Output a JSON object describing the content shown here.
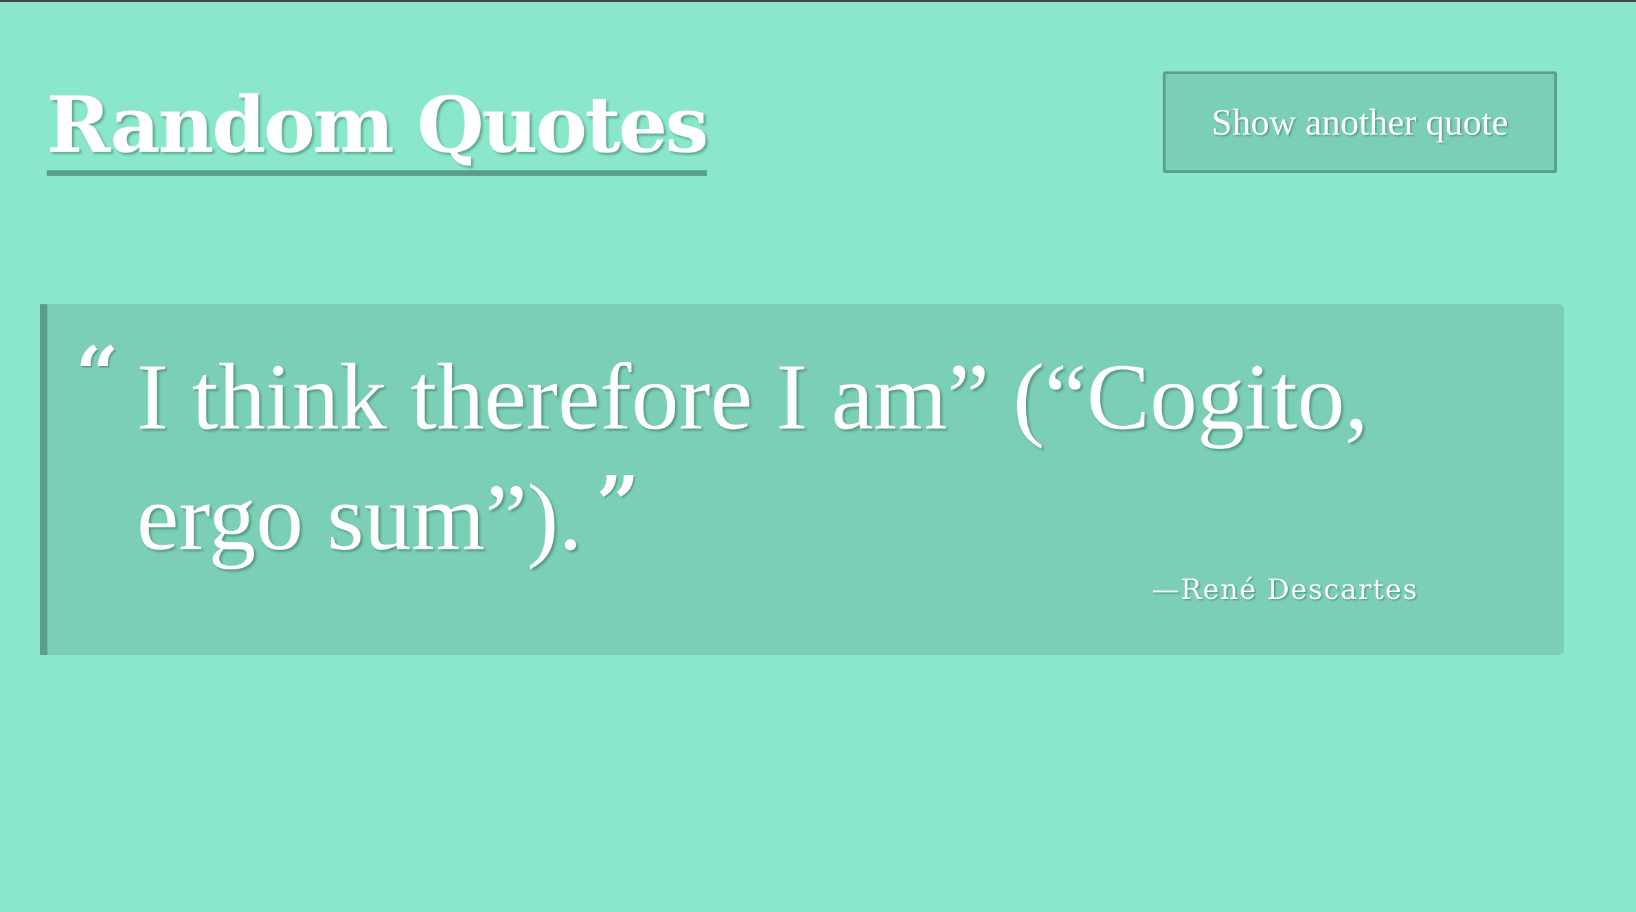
{
  "header": {
    "title": "Random Quotes",
    "button_label": "Show another quote"
  },
  "quote": {
    "open_mark": "“",
    "text": "I think therefore I am” (“Cogito, ergo sum”).",
    "close_mark": "”",
    "author": "—René Descartes"
  },
  "icons": {
    "open_quote": "open-quote-icon",
    "close_quote": "close-quote-icon"
  },
  "colors": {
    "background": "#8ae7cb",
    "card": "#7bcfb6",
    "accent": "#5a9e89",
    "text": "#ffffff"
  }
}
